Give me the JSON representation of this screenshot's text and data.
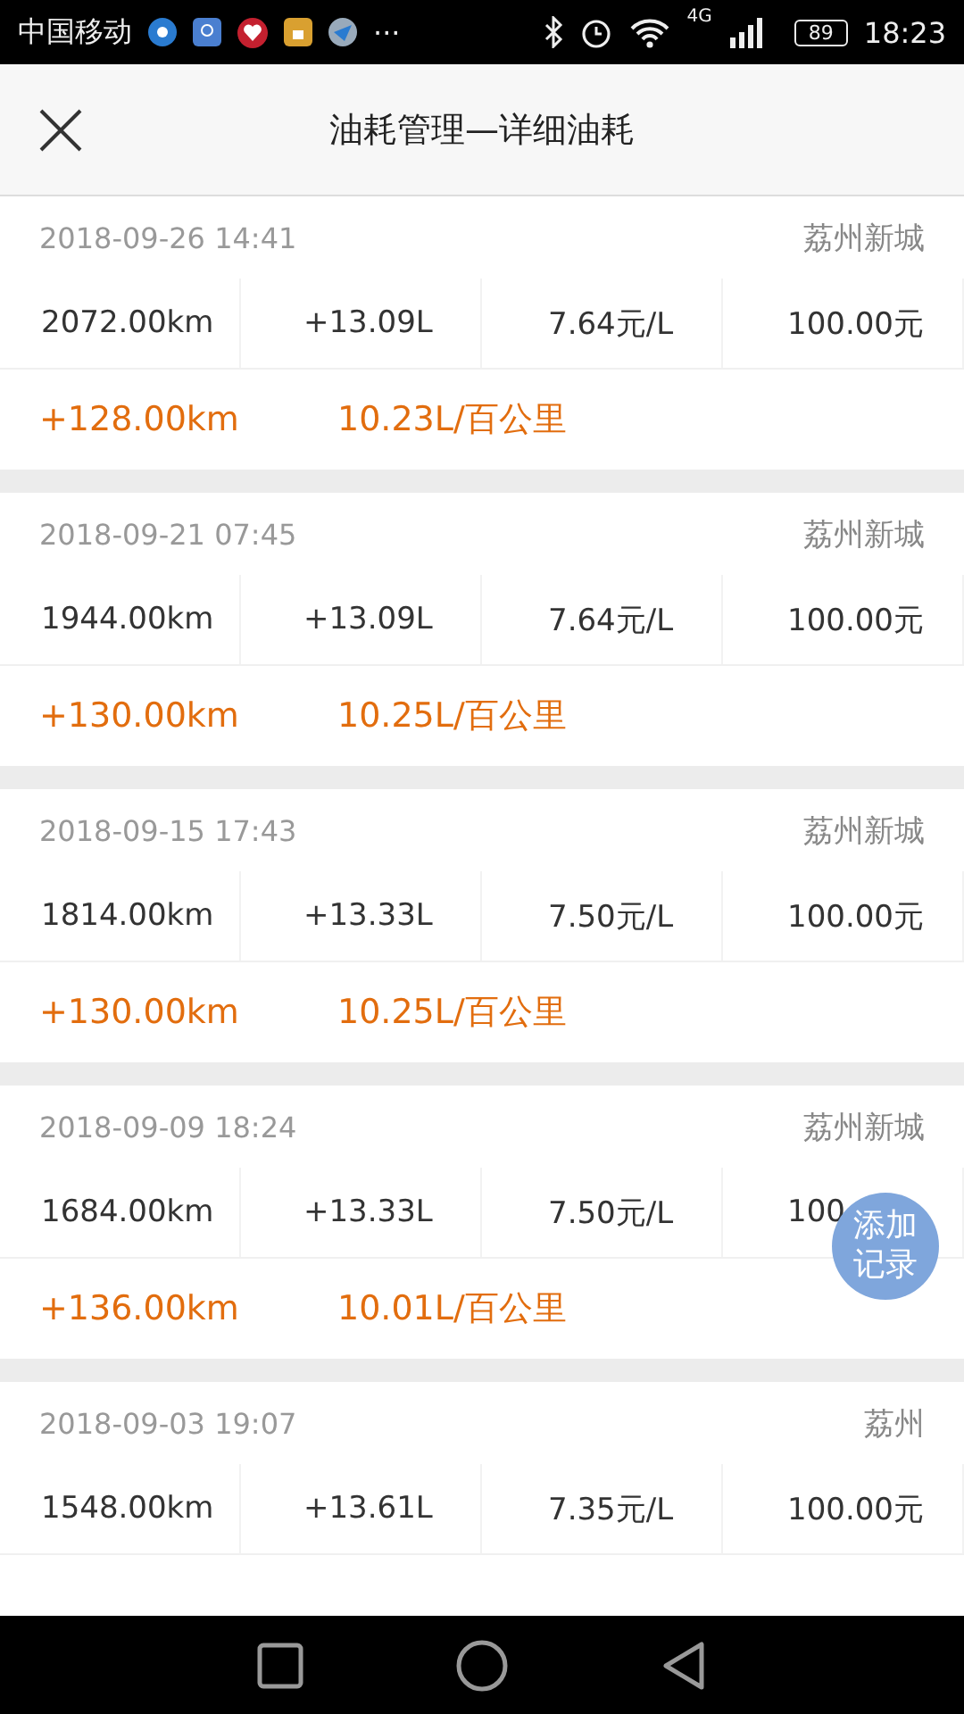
{
  "status_bar": {
    "carrier": "中国移动",
    "more": "···",
    "network": "4G",
    "battery": "89",
    "time": "18:23"
  },
  "header": {
    "title": "油耗管理—详细油耗"
  },
  "records": [
    {
      "date": "2018-09-26 14:41",
      "location": "荔州新城",
      "values": [
        "2072.00km",
        "+13.09L",
        "7.64元/L",
        "100.00元"
      ],
      "distance": "+128.00km",
      "consumption": "10.23L/百公里"
    },
    {
      "date": "2018-09-21 07:45",
      "location": "荔州新城",
      "values": [
        "1944.00km",
        "+13.09L",
        "7.64元/L",
        "100.00元"
      ],
      "distance": "+130.00km",
      "consumption": "10.25L/百公里"
    },
    {
      "date": "2018-09-15 17:43",
      "location": "荔州新城",
      "values": [
        "1814.00km",
        "+13.33L",
        "7.50元/L",
        "100.00元"
      ],
      "distance": "+130.00km",
      "consumption": "10.25L/百公里"
    },
    {
      "date": "2018-09-09 18:24",
      "location": "荔州新城",
      "values": [
        "1684.00km",
        "+13.33L",
        "7.50元/L",
        "100"
      ],
      "distance": "+136.00km",
      "consumption": "10.01L/百公里"
    },
    {
      "date": "2018-09-03 19:07",
      "location": "荔州",
      "values": [
        "1548.00km",
        "+13.61L",
        "7.35元/L",
        "100.00元"
      ]
    }
  ],
  "fab": {
    "label": "添加记录"
  }
}
